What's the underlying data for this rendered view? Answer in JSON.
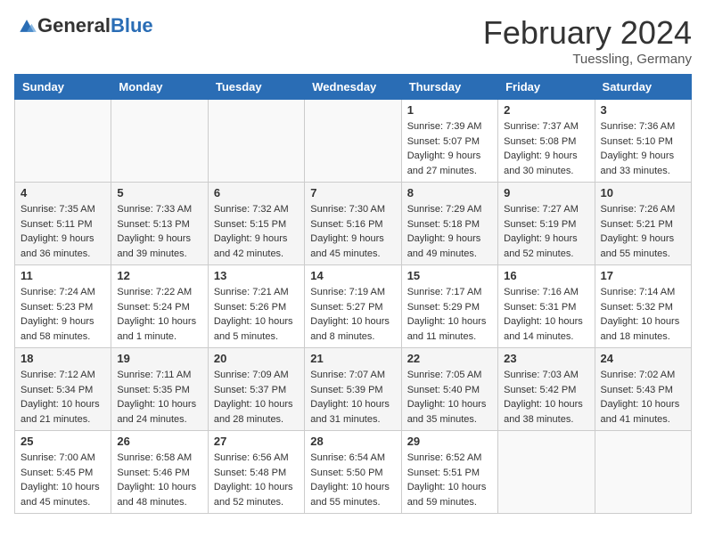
{
  "header": {
    "logo_general": "General",
    "logo_blue": "Blue",
    "month_title": "February 2024",
    "location": "Tuessling, Germany"
  },
  "weekdays": [
    "Sunday",
    "Monday",
    "Tuesday",
    "Wednesday",
    "Thursday",
    "Friday",
    "Saturday"
  ],
  "weeks": [
    [
      {
        "day": "",
        "sunrise": "",
        "sunset": "",
        "daylight": "",
        "empty": true
      },
      {
        "day": "",
        "sunrise": "",
        "sunset": "",
        "daylight": "",
        "empty": true
      },
      {
        "day": "",
        "sunrise": "",
        "sunset": "",
        "daylight": "",
        "empty": true
      },
      {
        "day": "",
        "sunrise": "",
        "sunset": "",
        "daylight": "",
        "empty": true
      },
      {
        "day": "1",
        "sunrise": "7:39 AM",
        "sunset": "5:07 PM",
        "daylight": "9 hours and 27 minutes.",
        "empty": false
      },
      {
        "day": "2",
        "sunrise": "7:37 AM",
        "sunset": "5:08 PM",
        "daylight": "9 hours and 30 minutes.",
        "empty": false
      },
      {
        "day": "3",
        "sunrise": "7:36 AM",
        "sunset": "5:10 PM",
        "daylight": "9 hours and 33 minutes.",
        "empty": false
      }
    ],
    [
      {
        "day": "4",
        "sunrise": "7:35 AM",
        "sunset": "5:11 PM",
        "daylight": "9 hours and 36 minutes.",
        "empty": false
      },
      {
        "day": "5",
        "sunrise": "7:33 AM",
        "sunset": "5:13 PM",
        "daylight": "9 hours and 39 minutes.",
        "empty": false
      },
      {
        "day": "6",
        "sunrise": "7:32 AM",
        "sunset": "5:15 PM",
        "daylight": "9 hours and 42 minutes.",
        "empty": false
      },
      {
        "day": "7",
        "sunrise": "7:30 AM",
        "sunset": "5:16 PM",
        "daylight": "9 hours and 45 minutes.",
        "empty": false
      },
      {
        "day": "8",
        "sunrise": "7:29 AM",
        "sunset": "5:18 PM",
        "daylight": "9 hours and 49 minutes.",
        "empty": false
      },
      {
        "day": "9",
        "sunrise": "7:27 AM",
        "sunset": "5:19 PM",
        "daylight": "9 hours and 52 minutes.",
        "empty": false
      },
      {
        "day": "10",
        "sunrise": "7:26 AM",
        "sunset": "5:21 PM",
        "daylight": "9 hours and 55 minutes.",
        "empty": false
      }
    ],
    [
      {
        "day": "11",
        "sunrise": "7:24 AM",
        "sunset": "5:23 PM",
        "daylight": "9 hours and 58 minutes.",
        "empty": false
      },
      {
        "day": "12",
        "sunrise": "7:22 AM",
        "sunset": "5:24 PM",
        "daylight": "10 hours and 1 minute.",
        "empty": false
      },
      {
        "day": "13",
        "sunrise": "7:21 AM",
        "sunset": "5:26 PM",
        "daylight": "10 hours and 5 minutes.",
        "empty": false
      },
      {
        "day": "14",
        "sunrise": "7:19 AM",
        "sunset": "5:27 PM",
        "daylight": "10 hours and 8 minutes.",
        "empty": false
      },
      {
        "day": "15",
        "sunrise": "7:17 AM",
        "sunset": "5:29 PM",
        "daylight": "10 hours and 11 minutes.",
        "empty": false
      },
      {
        "day": "16",
        "sunrise": "7:16 AM",
        "sunset": "5:31 PM",
        "daylight": "10 hours and 14 minutes.",
        "empty": false
      },
      {
        "day": "17",
        "sunrise": "7:14 AM",
        "sunset": "5:32 PM",
        "daylight": "10 hours and 18 minutes.",
        "empty": false
      }
    ],
    [
      {
        "day": "18",
        "sunrise": "7:12 AM",
        "sunset": "5:34 PM",
        "daylight": "10 hours and 21 minutes.",
        "empty": false
      },
      {
        "day": "19",
        "sunrise": "7:11 AM",
        "sunset": "5:35 PM",
        "daylight": "10 hours and 24 minutes.",
        "empty": false
      },
      {
        "day": "20",
        "sunrise": "7:09 AM",
        "sunset": "5:37 PM",
        "daylight": "10 hours and 28 minutes.",
        "empty": false
      },
      {
        "day": "21",
        "sunrise": "7:07 AM",
        "sunset": "5:39 PM",
        "daylight": "10 hours and 31 minutes.",
        "empty": false
      },
      {
        "day": "22",
        "sunrise": "7:05 AM",
        "sunset": "5:40 PM",
        "daylight": "10 hours and 35 minutes.",
        "empty": false
      },
      {
        "day": "23",
        "sunrise": "7:03 AM",
        "sunset": "5:42 PM",
        "daylight": "10 hours and 38 minutes.",
        "empty": false
      },
      {
        "day": "24",
        "sunrise": "7:02 AM",
        "sunset": "5:43 PM",
        "daylight": "10 hours and 41 minutes.",
        "empty": false
      }
    ],
    [
      {
        "day": "25",
        "sunrise": "7:00 AM",
        "sunset": "5:45 PM",
        "daylight": "10 hours and 45 minutes.",
        "empty": false
      },
      {
        "day": "26",
        "sunrise": "6:58 AM",
        "sunset": "5:46 PM",
        "daylight": "10 hours and 48 minutes.",
        "empty": false
      },
      {
        "day": "27",
        "sunrise": "6:56 AM",
        "sunset": "5:48 PM",
        "daylight": "10 hours and 52 minutes.",
        "empty": false
      },
      {
        "day": "28",
        "sunrise": "6:54 AM",
        "sunset": "5:50 PM",
        "daylight": "10 hours and 55 minutes.",
        "empty": false
      },
      {
        "day": "29",
        "sunrise": "6:52 AM",
        "sunset": "5:51 PM",
        "daylight": "10 hours and 59 minutes.",
        "empty": false
      },
      {
        "day": "",
        "sunrise": "",
        "sunset": "",
        "daylight": "",
        "empty": true
      },
      {
        "day": "",
        "sunrise": "",
        "sunset": "",
        "daylight": "",
        "empty": true
      }
    ]
  ],
  "labels": {
    "sunrise": "Sunrise:",
    "sunset": "Sunset:",
    "daylight": "Daylight:"
  }
}
